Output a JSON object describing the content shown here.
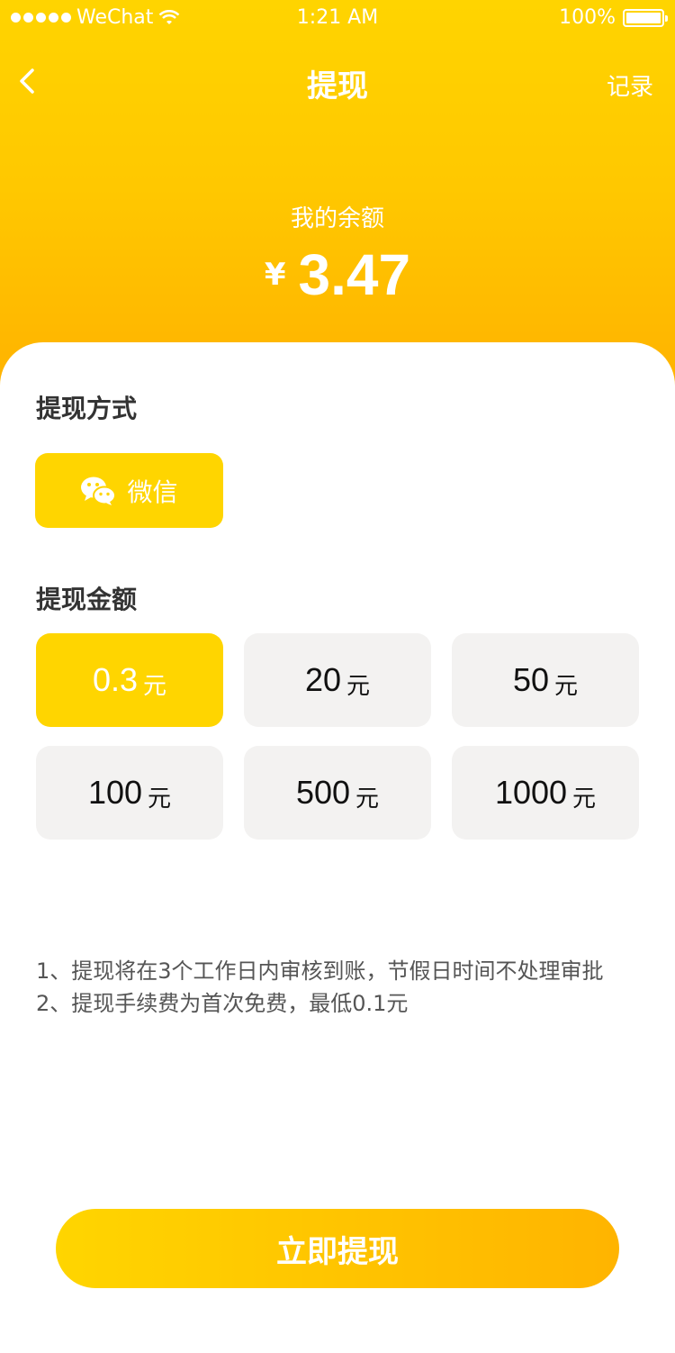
{
  "status_bar": {
    "carrier": "WeChat",
    "time": "1:21 AM",
    "battery_percent": "100%"
  },
  "nav": {
    "title": "提现",
    "record_label": "记录"
  },
  "balance": {
    "label": "我的余额",
    "currency": "¥",
    "amount": "3.47"
  },
  "method_section": {
    "title": "提现方式",
    "selected_method": "微信",
    "method_icon": "wechat-icon"
  },
  "amount_section": {
    "title": "提现金额",
    "options": [
      {
        "value": "0.3",
        "unit": "元",
        "selected": true
      },
      {
        "value": "20",
        "unit": "元",
        "selected": false
      },
      {
        "value": "50",
        "unit": "元",
        "selected": false
      },
      {
        "value": "100",
        "unit": "元",
        "selected": false
      },
      {
        "value": "500",
        "unit": "元",
        "selected": false
      },
      {
        "value": "1000",
        "unit": "元",
        "selected": false
      }
    ]
  },
  "notes": [
    "1、提现将在3个工作日内审核到账，节假日时间不处理审批",
    "2、提现手续费为首次免费，最低0.1元"
  ],
  "submit_label": "立即提现",
  "colors": {
    "accent": "#FFD500",
    "accent_dark": "#FFB000",
    "option_bg": "#F3F2F1"
  }
}
